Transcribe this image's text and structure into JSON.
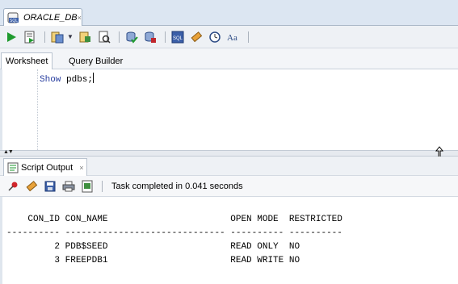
{
  "document_tab": {
    "title": "ORACLE_DB",
    "close": "×"
  },
  "toolbar": {
    "icons": [
      "run-statement-icon",
      "run-script-icon",
      "commit-icon",
      "rollback-icon",
      "explain-plan-icon",
      "autotrace-icon",
      "sql-tuning-icon",
      "clear-icon",
      "history-icon",
      "format-icon"
    ]
  },
  "worksheet_tabs": [
    "Worksheet",
    "Query Builder"
  ],
  "editor": {
    "keyword": "Show",
    "rest": " pdbs;"
  },
  "script_output": {
    "tab_label": "Script Output",
    "close": "×",
    "status": "Task completed in 0.041 seconds",
    "lines": [
      "    CON_ID CON_NAME                       OPEN MODE  RESTRICTED",
      "---------- ------------------------------ ---------- ----------",
      "         2 PDB$SEED                       READ ONLY  NO",
      "         3 FREEPDB1                       READ WRITE NO"
    ]
  },
  "colors": {
    "accent": "#2a3fa0",
    "toolbar_bg": "#eef1f5",
    "tab_strip_bg": "#dce6f2"
  }
}
